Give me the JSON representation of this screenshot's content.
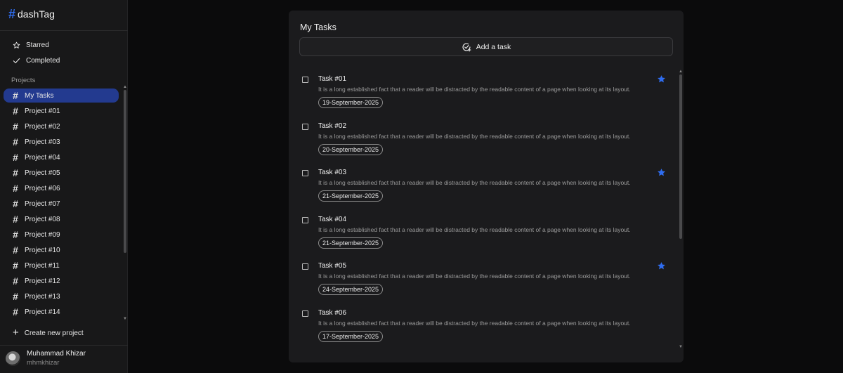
{
  "app": {
    "logo_hash": "#",
    "name": "dashTag"
  },
  "nav": [
    {
      "label": "Starred",
      "icon": "star-outline-icon"
    },
    {
      "label": "Completed",
      "icon": "check-icon"
    }
  ],
  "projects_section": {
    "title": "Projects",
    "create_label": "Create new project"
  },
  "projects": [
    {
      "label": "My Tasks",
      "active": true
    },
    {
      "label": "Project #01"
    },
    {
      "label": "Project #02"
    },
    {
      "label": "Project #03"
    },
    {
      "label": "Project #04"
    },
    {
      "label": "Project #05"
    },
    {
      "label": "Project #06"
    },
    {
      "label": "Project #07"
    },
    {
      "label": "Project #08"
    },
    {
      "label": "Project #09"
    },
    {
      "label": "Project #10"
    },
    {
      "label": "Project #11"
    },
    {
      "label": "Project #12"
    },
    {
      "label": "Project #13"
    },
    {
      "label": "Project #14"
    }
  ],
  "user": {
    "name": "Muhammad Khizar",
    "handle": "mhmkhizar"
  },
  "panel": {
    "title": "My Tasks",
    "add_task_label": "Add a task"
  },
  "tasks": [
    {
      "title": "Task #01",
      "description": "It is a long established fact that a reader will be distracted by the readable content of a page when looking at its layout.",
      "date": "19-September-2025",
      "starred": true
    },
    {
      "title": "Task #02",
      "description": "It is a long established fact that a reader will be distracted by the readable content of a page when looking at its layout.",
      "date": "20-September-2025",
      "starred": false
    },
    {
      "title": "Task #03",
      "description": "It is a long established fact that a reader will be distracted by the readable content of a page when looking at its layout.",
      "date": "21-September-2025",
      "starred": true
    },
    {
      "title": "Task #04",
      "description": "It is a long established fact that a reader will be distracted by the readable content of a page when looking at its layout.",
      "date": "21-September-2025",
      "starred": false
    },
    {
      "title": "Task #05",
      "description": "It is a long established fact that a reader will be distracted by the readable content of a page when looking at its layout.",
      "date": "24-September-2025",
      "starred": true
    },
    {
      "title": "Task #06",
      "description": "It is a long established fact that a reader will be distracted by the readable content of a page when looking at its layout.",
      "date": "17-September-2025",
      "starred": false
    }
  ],
  "colors": {
    "accent": "#2f6df0",
    "active_bg": "#233a8f",
    "star": "#2f6df0",
    "background": "#0b0b0c",
    "panel": "#1b1b1d"
  }
}
